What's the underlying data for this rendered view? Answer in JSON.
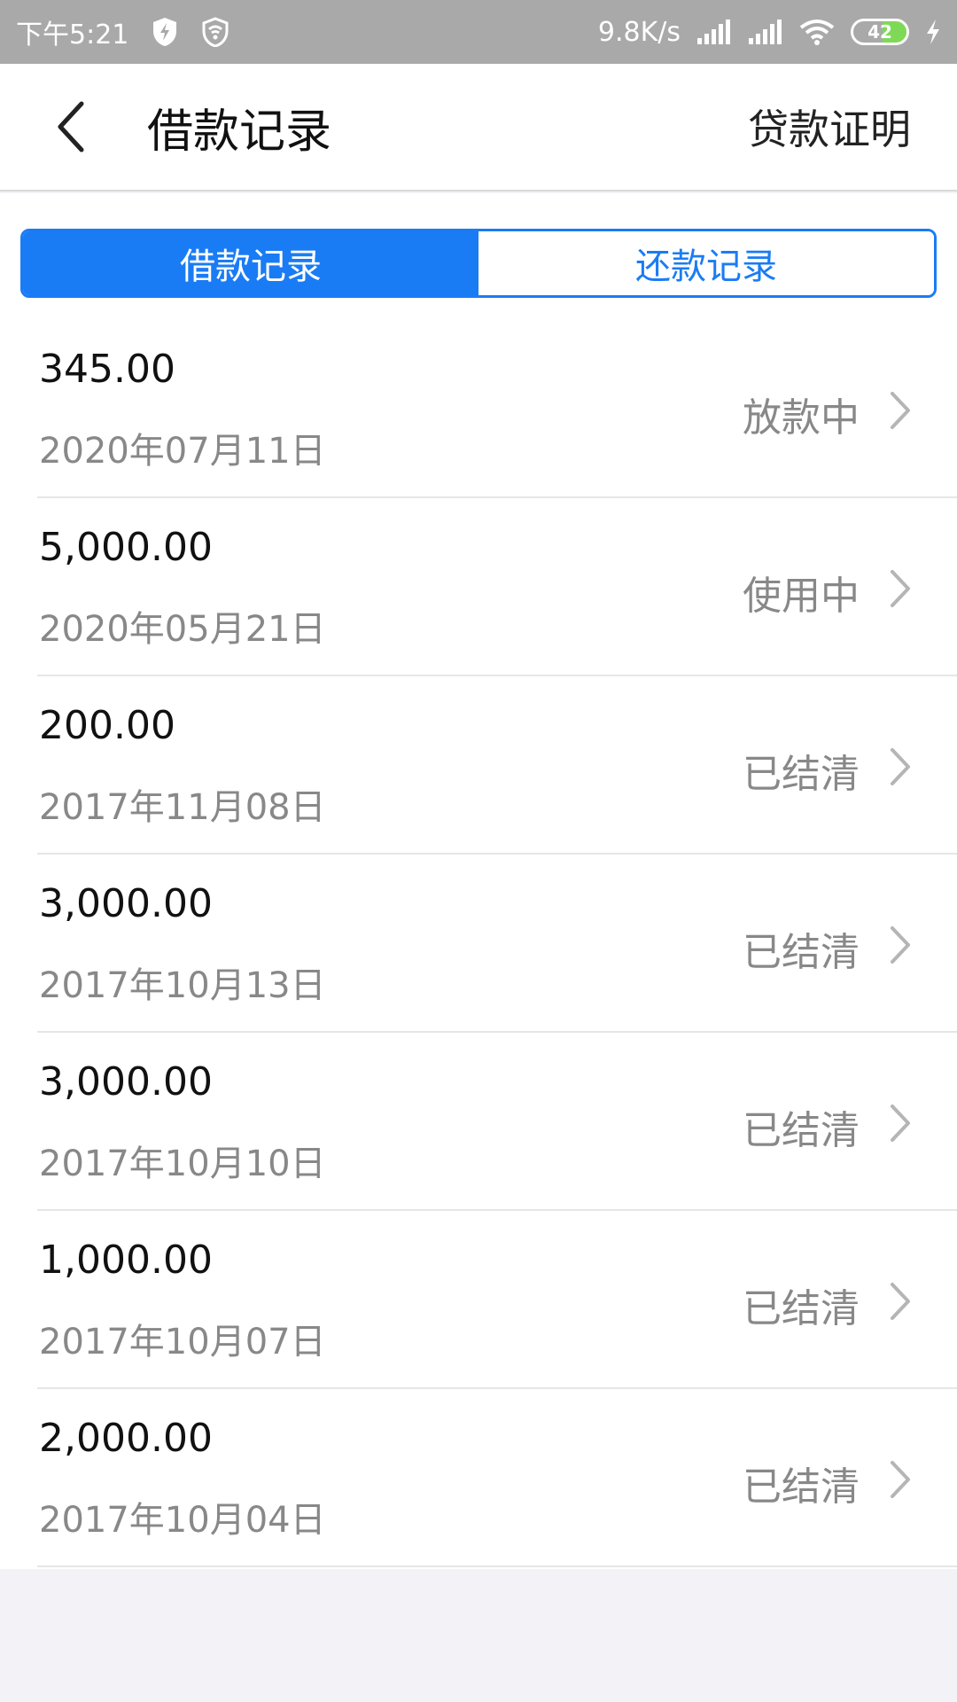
{
  "status_bar": {
    "time": "下午5:21",
    "net_speed": "9.8K/s",
    "battery": "42",
    "icons": [
      "shield-icon",
      "vpn-shield-icon",
      "signal-icon",
      "signal-icon",
      "wifi-icon",
      "battery-icon",
      "charging-icon"
    ]
  },
  "header": {
    "title": "借款记录",
    "action": "贷款证明"
  },
  "tabs": {
    "active": "借款记录",
    "inactive": "还款记录"
  },
  "colors": {
    "accent": "#1a7cf5",
    "status_bar_bg": "#a9a9a9",
    "muted_text": "#888888"
  },
  "records": [
    {
      "amount": "345.00",
      "date": "2020年07月11日",
      "status": "放款中"
    },
    {
      "amount": "5,000.00",
      "date": "2020年05月21日",
      "status": "使用中"
    },
    {
      "amount": "200.00",
      "date": "2017年11月08日",
      "status": "已结清"
    },
    {
      "amount": "3,000.00",
      "date": "2017年10月13日",
      "status": "已结清"
    },
    {
      "amount": "3,000.00",
      "date": "2017年10月10日",
      "status": "已结清"
    },
    {
      "amount": "1,000.00",
      "date": "2017年10月07日",
      "status": "已结清"
    },
    {
      "amount": "2,000.00",
      "date": "2017年10月04日",
      "status": "已结清"
    }
  ]
}
